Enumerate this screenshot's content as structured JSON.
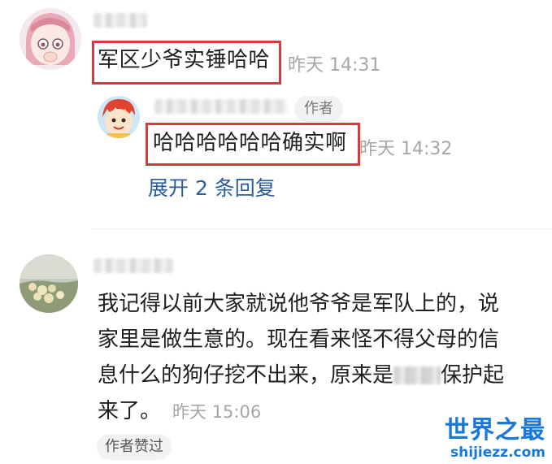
{
  "comments": [
    {
      "text": "军区少爷实锤哈哈",
      "time": "昨天 14:31",
      "reply": {
        "badge": "作者",
        "text": "哈哈哈哈哈哈确实啊",
        "time": "昨天 14:32"
      },
      "expand_label": "展开 2 条回复"
    },
    {
      "lines": [
        "我记得以前大家就说他爷爷是军队上的，说",
        "家里是做生意的。现在看来怪不得父母的信",
        "息什么的狗仔挖不出来，原来是",
        "保护起",
        "来了。"
      ],
      "time": "昨天 15:06",
      "liked_label": "作者赞过"
    }
  ],
  "watermark": {
    "title": "世界之最",
    "url": "shijiezz.com"
  },
  "colors": {
    "highlight": "#d9383a",
    "link": "#2a5d9c",
    "watermark": "#1878d8"
  }
}
